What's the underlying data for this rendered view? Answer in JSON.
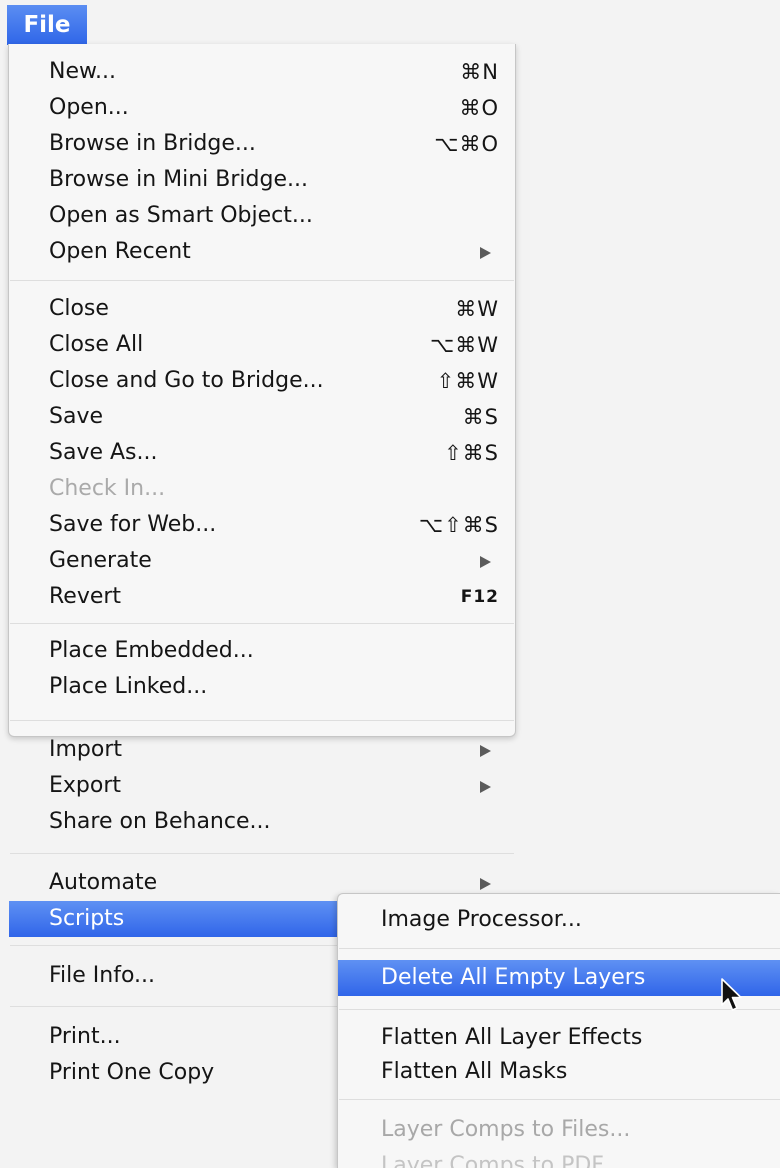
{
  "menu_title": "File",
  "file_menu": {
    "items": [
      {
        "label": "New...",
        "shortcut": "⌘N"
      },
      {
        "label": "Open...",
        "shortcut": "⌘O"
      },
      {
        "label": "Browse in Bridge...",
        "shortcut": "⌥⌘O"
      },
      {
        "label": "Browse in Mini Bridge...",
        "shortcut": ""
      },
      {
        "label": "Open as Smart Object...",
        "shortcut": ""
      },
      {
        "label": "Open Recent",
        "shortcut": "",
        "submenu": true
      },
      {
        "label": "Close",
        "shortcut": "⌘W"
      },
      {
        "label": "Close All",
        "shortcut": "⌥⌘W"
      },
      {
        "label": "Close and Go to Bridge...",
        "shortcut": "⇧⌘W"
      },
      {
        "label": "Save",
        "shortcut": "⌘S"
      },
      {
        "label": "Save As...",
        "shortcut": "⇧⌘S"
      },
      {
        "label": "Check In...",
        "shortcut": "",
        "disabled": true
      },
      {
        "label": "Save for Web...",
        "shortcut": "⌥⇧⌘S"
      },
      {
        "label": "Generate",
        "shortcut": "",
        "submenu": true
      },
      {
        "label": "Revert",
        "shortcut": "F12"
      },
      {
        "label": "Place Embedded...",
        "shortcut": ""
      },
      {
        "label": "Place Linked...",
        "shortcut": ""
      },
      {
        "label": "Import",
        "shortcut": "",
        "submenu": true
      },
      {
        "label": "Export",
        "shortcut": "",
        "submenu": true
      },
      {
        "label": "Share on Behance...",
        "shortcut": ""
      },
      {
        "label": "Automate",
        "shortcut": "",
        "submenu": true
      },
      {
        "label": "Scripts",
        "shortcut": "",
        "submenu": true,
        "selected": true
      },
      {
        "label": "File Info...",
        "shortcut": ""
      },
      {
        "label": "Print...",
        "shortcut": ""
      },
      {
        "label": "Print One Copy",
        "shortcut": ""
      }
    ]
  },
  "scripts_submenu": {
    "items": [
      {
        "label": "Image Processor..."
      },
      {
        "label": "Delete All Empty Layers",
        "selected": true
      },
      {
        "label": "Flatten All Layer Effects"
      },
      {
        "label": "Flatten All Masks"
      },
      {
        "label": "Layer Comps to Files...",
        "disabled": true
      },
      {
        "label": "Layer Comps to PDF...",
        "disabled": true
      }
    ]
  },
  "icons": {
    "submenu_arrow": "triangle-right-icon",
    "pointer": "mouse-pointer-icon"
  },
  "colors": {
    "selection": "#3a6ff0",
    "menu_background": "#f7f7f7",
    "disabled_text": "#aaaaaa"
  }
}
